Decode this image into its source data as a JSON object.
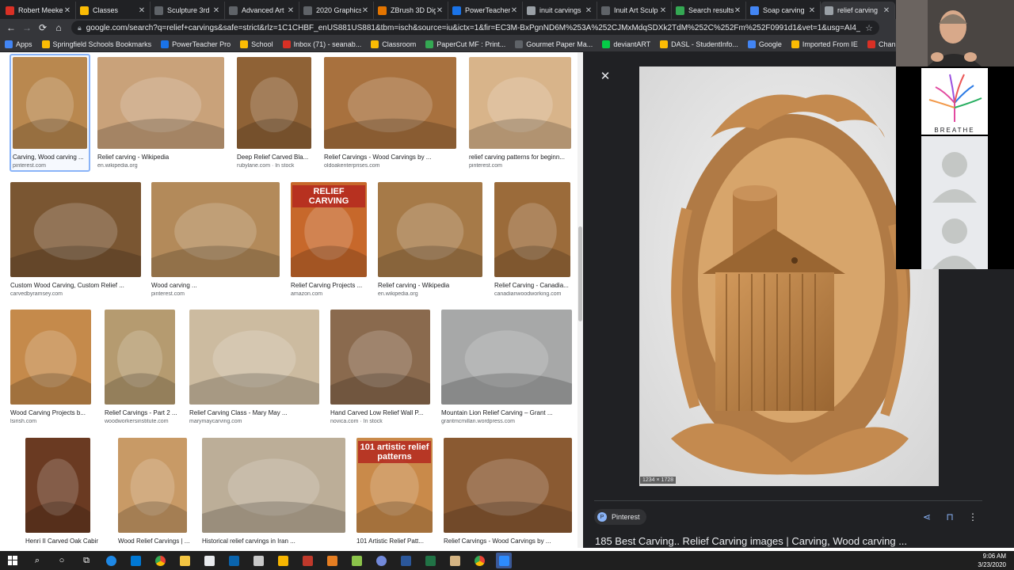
{
  "tabs": [
    {
      "label": "Robert Meeke",
      "color": "#d93025"
    },
    {
      "label": "Classes",
      "color": "#fbbc04"
    },
    {
      "label": "Sculpture 3rd",
      "color": "#5f6368"
    },
    {
      "label": "Advanced Art",
      "color": "#5f6368"
    },
    {
      "label": "2020 Graphics",
      "color": "#5f6368"
    },
    {
      "label": "ZBrush 3D Dig",
      "color": "#e37400"
    },
    {
      "label": "PowerTeacher",
      "color": "#1a73e8"
    },
    {
      "label": "inuit carvings",
      "color": "#9aa0a6"
    },
    {
      "label": "Inuit Art Sculp",
      "color": "#5f6368"
    },
    {
      "label": "Search results",
      "color": "#34a853"
    },
    {
      "label": "Soap carving",
      "color": "#4285f4"
    },
    {
      "label": "relief carving",
      "color": "#9aa0a6",
      "active": true
    }
  ],
  "toolbar": {
    "url": "google.com/search?q=relief+carvings&safe=strict&rlz=1C1CHBF_enUS881US881&tbm=isch&source=iu&ictx=1&fir=EC3M-BxPgnND6M%253A%252CJMxMdqSDXk2TdM%252C%252Fm%252F0991d1&vet=1&usg=AI4_-kTHXotRAxZy0z1w..."
  },
  "bookmarks": [
    {
      "label": "Apps",
      "color": "#4285f4"
    },
    {
      "label": "Springfield Schools Bookmarks",
      "color": "#fbbc04"
    },
    {
      "label": "PowerTeacher Pro",
      "color": "#1a73e8"
    },
    {
      "label": "School",
      "color": "#fbbc04"
    },
    {
      "label": "Inbox (71) - seanab...",
      "color": "#d93025"
    },
    {
      "label": "Classroom",
      "color": "#fbbc04"
    },
    {
      "label": "PaperCut MF : Print...",
      "color": "#34a853"
    },
    {
      "label": "Gourmet Paper Ma...",
      "color": "#5f6368"
    },
    {
      "label": "deviantART",
      "color": "#05cc47"
    },
    {
      "label": "DASL - StudentInfo...",
      "color": "#fbbc04"
    },
    {
      "label": "Google",
      "color": "#4285f4"
    },
    {
      "label": "Imported From IE",
      "color": "#fbbc04"
    },
    {
      "label": "Channel dashboard...",
      "color": "#d93025"
    }
  ],
  "results": [
    {
      "caption": "Carving, Wood carving ...",
      "source": "pinterest.com"
    },
    {
      "caption": "Relief carving - Wikipedia",
      "source": "en.wikipedia.org"
    },
    {
      "caption": "Deep Relief Carved Bla...",
      "source": "rubylane.com · In stock"
    },
    {
      "caption": "Relief Carvings - Wood Carvings by ...",
      "source": "oldoakenterprises.com"
    },
    {
      "caption": "relief carving patterns for beginn...",
      "source": "pinterest.com"
    },
    {
      "caption": "Custom Wood Carving, Custom Relief ...",
      "source": "carvedbyramsey.com"
    },
    {
      "caption": "Wood carving ...",
      "source": "pinterest.com"
    },
    {
      "caption": "Relief Carving Projects ...",
      "source": "amazon.com",
      "cover": "RELIEF CARVING"
    },
    {
      "caption": "Relief carving - Wikipedia",
      "source": "en.wikipedia.org"
    },
    {
      "caption": "Relief Carving - Canadia...",
      "source": "canadianwoodworking.com"
    },
    {
      "caption": "Wood Carving Projects b...",
      "source": "lsirish.com"
    },
    {
      "caption": "Relief Carvings - Part 2 ...",
      "source": "woodworkersinstitute.com"
    },
    {
      "caption": "Relief Carving Class - Mary May ...",
      "source": "marymaycarving.com"
    },
    {
      "caption": "Hand Carved Low Relief Wall P...",
      "source": "novica.com · In stock"
    },
    {
      "caption": "Mountain Lion Relief Carving – Grant ...",
      "source": "grantmcmillan.wordpress.com"
    },
    {
      "caption": "Henri II Carved Oak Cabinet ...",
      "source": ""
    },
    {
      "caption": "Wood Relief Carvings | ...",
      "source": ""
    },
    {
      "caption": "Historical relief carvings in Iran ...",
      "source": ""
    },
    {
      "caption": "101 Artistic Relief Patt...",
      "source": "",
      "cover": "101 artistic relief patterns"
    },
    {
      "caption": "Relief Carvings - Wood Carvings by ...",
      "source": ""
    }
  ],
  "preview": {
    "dimensions": "1234 × 1728",
    "source_name": "Pinterest",
    "title": "185 Best Carving.. Relief Carving images | Carving, Wood carving ..."
  },
  "video": {
    "tile_label": "BREATHE"
  },
  "clock": {
    "time": "9:06 AM",
    "date": "3/23/2020"
  },
  "colors": {
    "panel_bg": "#202124",
    "accent": "#8ab4f8",
    "wood": "#b07a45"
  }
}
